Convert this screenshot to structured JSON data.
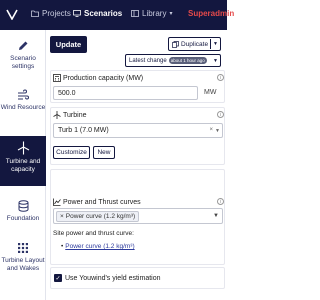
{
  "topbar": {
    "projects_label": "Projects",
    "scenarios_label": "Scenarios",
    "library_label": "Library",
    "library_caret": "▾",
    "user_label": "Superadmin"
  },
  "sidebar": {
    "items": [
      {
        "label": "Scenario settings",
        "icon": "pencil-icon"
      },
      {
        "label": "Wind Resource",
        "icon": "wind-icon"
      },
      {
        "label": "Turbine and capacity",
        "icon": "turbine-icon"
      },
      {
        "label": "Foundation",
        "icon": "database-icon"
      },
      {
        "label": "Turbine Layout and Wakes",
        "icon": "grid-icon"
      }
    ]
  },
  "toolbar": {
    "update_label": "Update",
    "duplicate_label": "Duplicate",
    "latest_label": "Latest change",
    "latest_badge": "about 1 hour ago"
  },
  "capacity": {
    "label": "Production capacity (MW)",
    "value": "500.0",
    "unit": "MW"
  },
  "turbine": {
    "label": "Turbine",
    "selected": "Turb 1 (7.0 MW)",
    "customize_label": "Customize",
    "new_label": "New"
  },
  "curves": {
    "label": "Power and Thrust curves",
    "tag": "Power curve (1.2 kg/m³)",
    "site_label": "Site power and thrust curve:",
    "site_link": "Power curve (1.2 kg/m³)"
  },
  "yield": {
    "label": "Use Youwind's yield estimation",
    "checked": true
  },
  "colors": {
    "navy": "#13173f",
    "user_red": "#e54a4a"
  }
}
